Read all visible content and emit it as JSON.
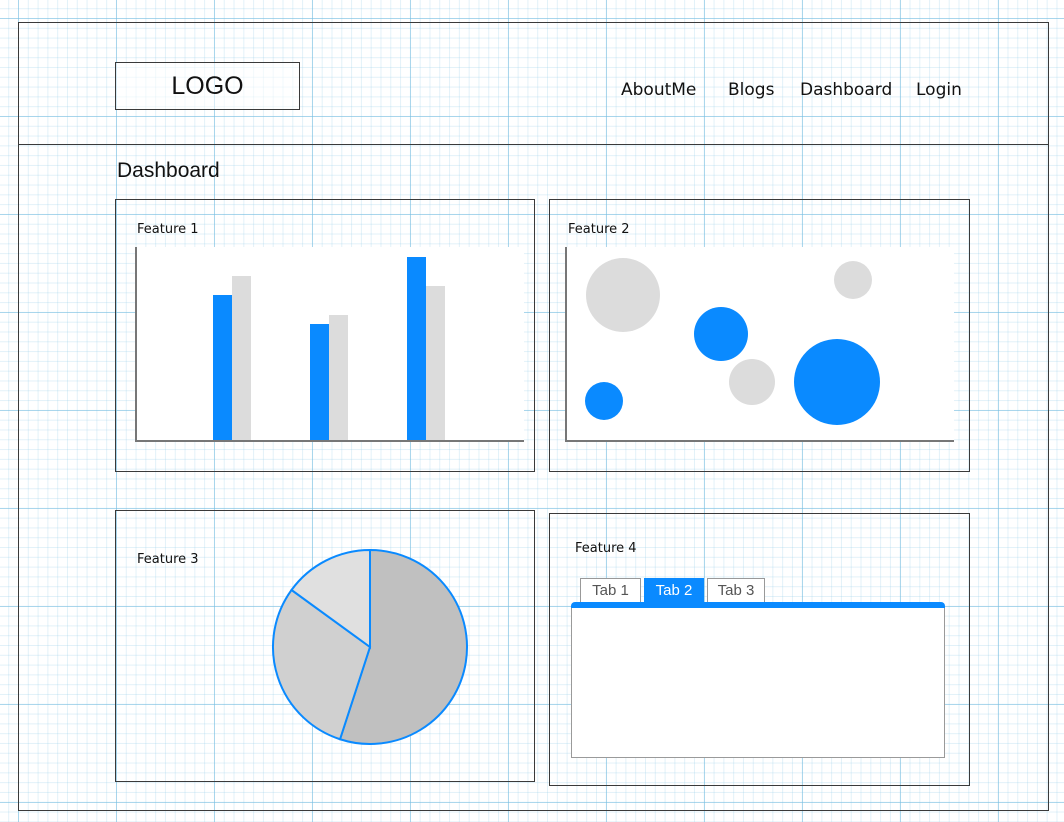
{
  "header": {
    "logo_text": "LOGO",
    "nav": [
      {
        "label": "AboutMe"
      },
      {
        "label": "Blogs"
      },
      {
        "label": "Dashboard"
      },
      {
        "label": "Login"
      }
    ]
  },
  "page": {
    "title": "Dashboard"
  },
  "colors": {
    "accent": "#0a8aff",
    "light_gray": "#dcdcdc",
    "pie_dark": "#c0c0c0",
    "pie_mid": "#d0d0d0",
    "pie_light": "#e0e0e0"
  },
  "feature1": {
    "label": "Feature 1",
    "chart_data": {
      "type": "bar",
      "categories": [
        "",
        "",
        ""
      ],
      "series": [
        {
          "values": [
            75,
            60,
            95
          ],
          "color": "#0a8aff"
        },
        {
          "values": [
            85,
            65,
            80
          ],
          "color": "#dcdcdc"
        }
      ],
      "ylim": [
        0,
        100
      ]
    }
  },
  "feature2": {
    "label": "Feature 2",
    "chart_data": {
      "type": "scatter",
      "xlim": [
        0,
        100
      ],
      "ylim": [
        0,
        100
      ],
      "points": [
        {
          "x": 15,
          "y": 75,
          "r": 37,
          "color": "#dcdcdc"
        },
        {
          "x": 40,
          "y": 55,
          "r": 27,
          "color": "#0a8aff"
        },
        {
          "x": 48,
          "y": 30,
          "r": 23,
          "color": "#dcdcdc"
        },
        {
          "x": 74,
          "y": 83,
          "r": 19,
          "color": "#dcdcdc"
        },
        {
          "x": 70,
          "y": 30,
          "r": 43,
          "color": "#0a8aff"
        },
        {
          "x": 10,
          "y": 20,
          "r": 19,
          "color": "#0a8aff"
        }
      ]
    }
  },
  "feature3": {
    "label": "Feature 3",
    "chart_data": {
      "type": "pie",
      "values": [
        55,
        30,
        15
      ],
      "colors": [
        "#c0c0c0",
        "#d0d0d0",
        "#e0e0e0"
      ],
      "stroke": "#0a8aff"
    }
  },
  "feature4": {
    "label": "Feature 4",
    "tabs": [
      {
        "label": "Tab 1",
        "active": false
      },
      {
        "label": "Tab 2",
        "active": true
      },
      {
        "label": "Tab 3",
        "active": false
      }
    ]
  }
}
